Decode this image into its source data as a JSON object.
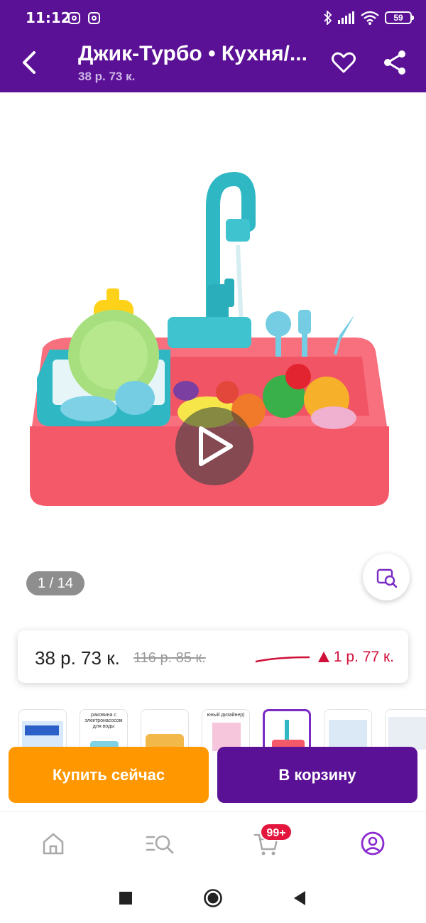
{
  "status_bar": {
    "time": "11:12",
    "battery": "59",
    "icons": [
      "instagram-icon",
      "instagram-icon",
      "bluetooth-icon",
      "signal-icon",
      "wifi-icon",
      "battery-icon"
    ]
  },
  "header": {
    "title": "Джик-Турбо • Кухня/...",
    "price": "38 р. 73 к.",
    "back_icon": "back-arrow-icon",
    "favorite_icon": "heart-icon",
    "share_icon": "share-icon",
    "background": "#5b1196"
  },
  "gallery": {
    "counter": "1 / 14",
    "play_icon": "play-icon",
    "zoom_icon": "image-search-icon"
  },
  "price_card": {
    "current": "38 р. 73 к.",
    "old": "116 р. 85 к.",
    "change": "1 р. 77 к.",
    "change_icon": "arrow-up-triangle-icon",
    "change_color": "#d0103a"
  },
  "thumbnails": [
    {
      "caption": ""
    },
    {
      "caption": "раковина с электронасосом для воды"
    },
    {
      "caption": ""
    },
    {
      "caption": "юный дизайнер)"
    },
    {
      "caption": "",
      "active": true
    },
    {
      "caption": ""
    },
    {
      "caption": ""
    }
  ],
  "actions": {
    "buy_now": "Купить сейчас",
    "add_to_cart": "В корзину",
    "buy_color": "#ff9800",
    "cart_color": "#5b1196"
  },
  "bottom_nav": {
    "items": [
      "home-icon",
      "catalog-search-icon",
      "cart-icon",
      "profile-icon"
    ],
    "cart_badge": "99+",
    "active": "profile-icon"
  },
  "system_nav": [
    "recents-square-icon",
    "home-circle-icon",
    "back-triangle-icon"
  ]
}
